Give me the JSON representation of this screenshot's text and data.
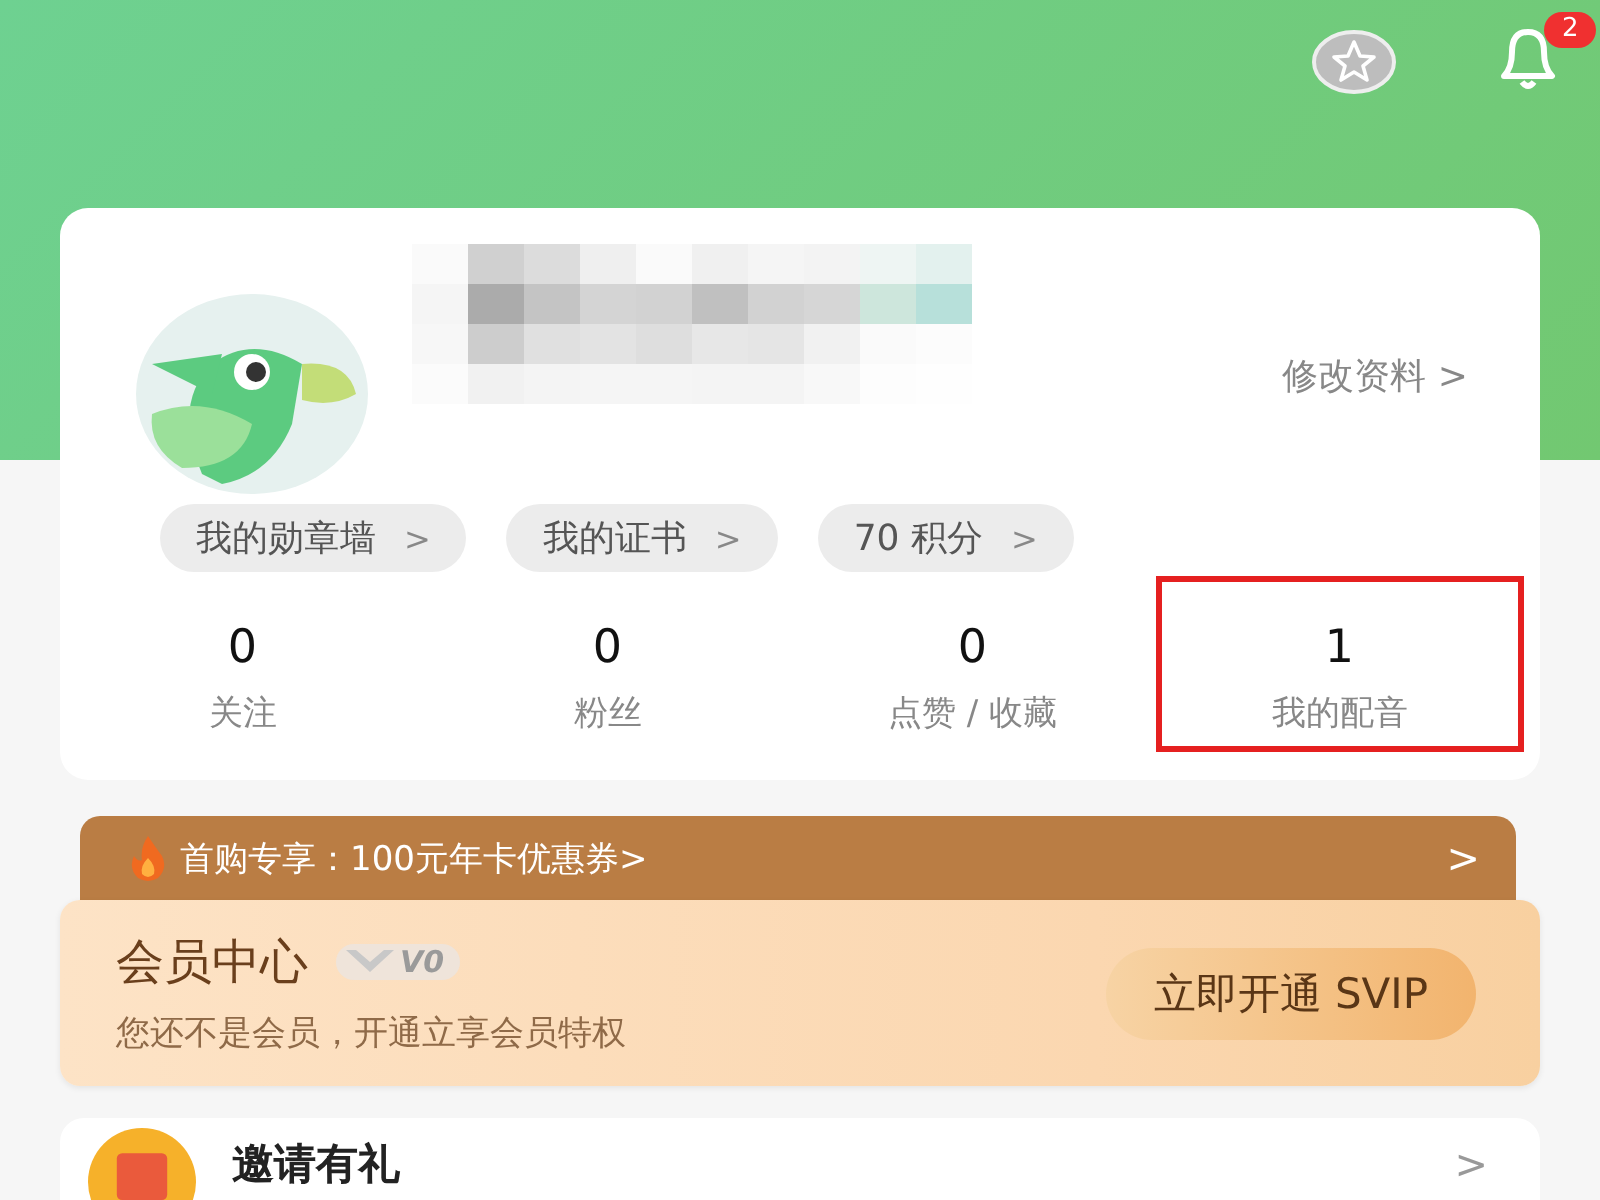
{
  "top_bar": {
    "notification_badge": "2"
  },
  "profile": {
    "edit_link": "修改资料 >",
    "chips": [
      {
        "label": "我的勋章墙",
        "arrow": ">"
      },
      {
        "label": "我的证书",
        "arrow": ">"
      },
      {
        "label": "70 积分",
        "arrow": ">"
      }
    ],
    "stats": [
      {
        "value": "0",
        "label": "关注",
        "highlighted": false
      },
      {
        "value": "0",
        "label": "粉丝",
        "highlighted": false
      },
      {
        "value": "0",
        "label": "点赞 / 收藏",
        "highlighted": false
      },
      {
        "value": "1",
        "label": "我的配音",
        "highlighted": true
      }
    ]
  },
  "promo": {
    "text": "首购专享：100元年卡优惠券>",
    "arrow": ">"
  },
  "membership": {
    "title": "会员中心",
    "level": "V0",
    "subtitle": "您还不是会员，开通立享会员特权",
    "button": "立即开通 SVIP"
  },
  "menu": [
    {
      "label": "邀请有礼",
      "arrow": ">"
    }
  ]
}
